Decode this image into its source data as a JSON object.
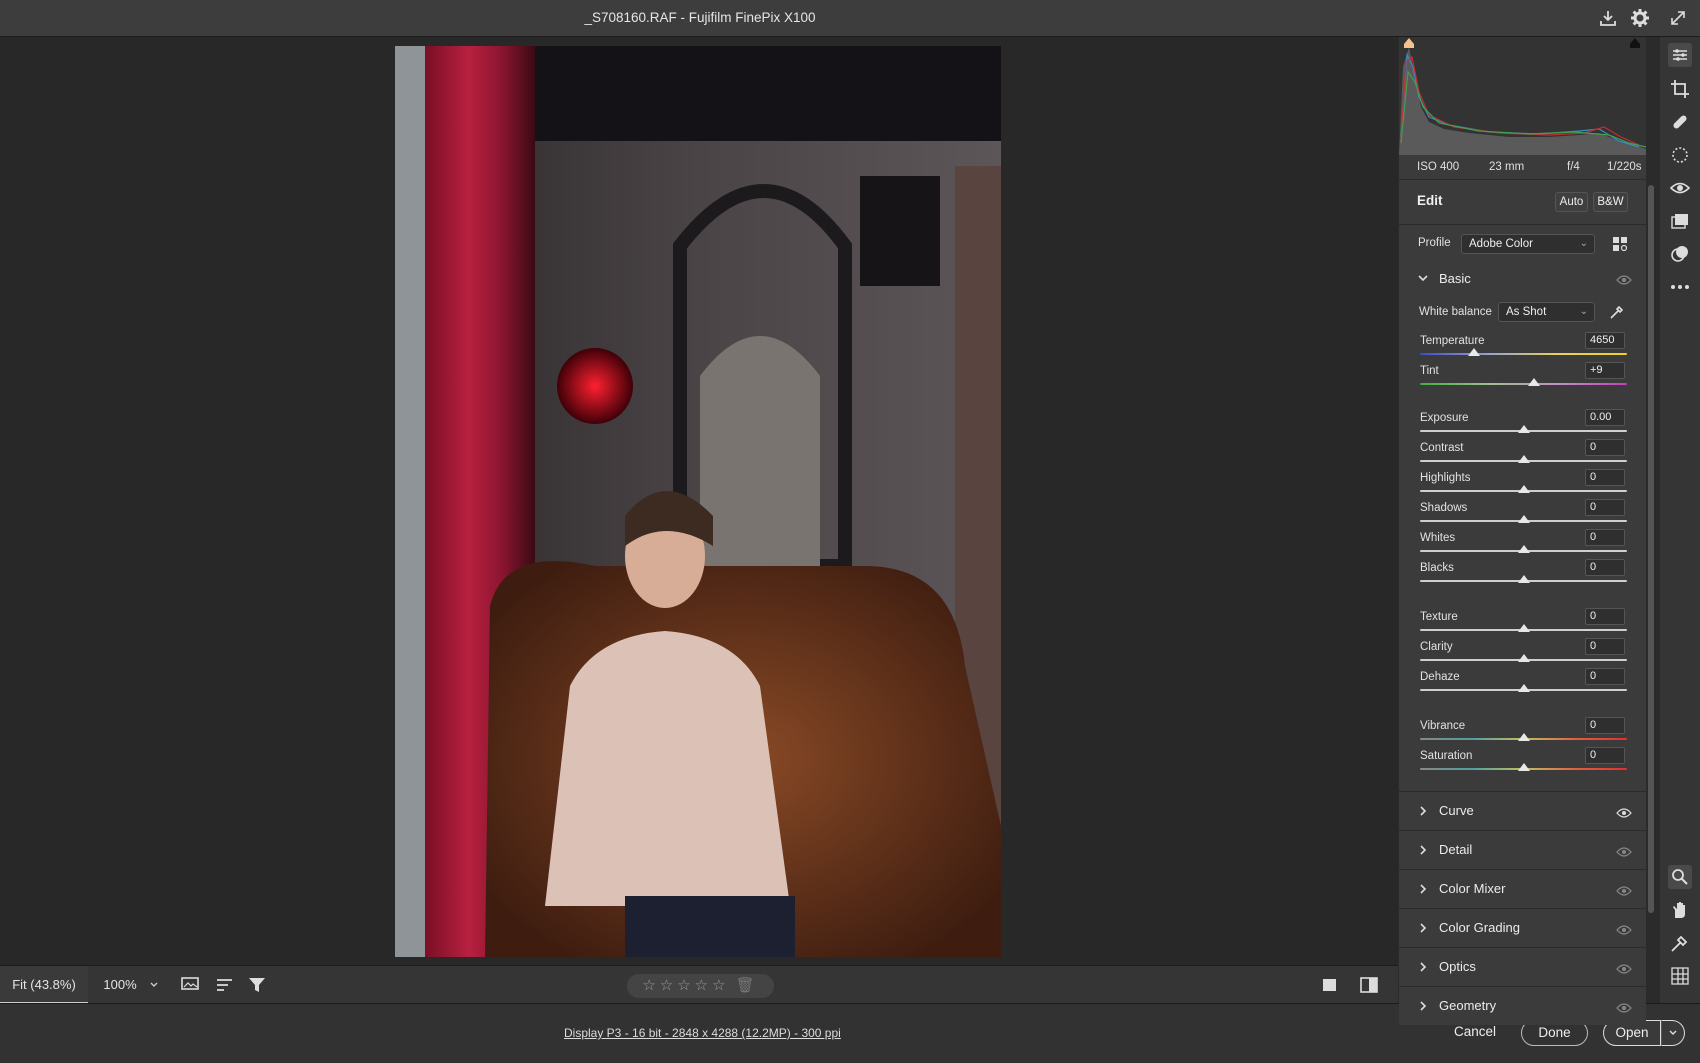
{
  "window": {
    "title": "_S708160.RAF  -  Fujifilm FinePix X100"
  },
  "histogram": {
    "exif": {
      "iso": "ISO 400",
      "focal_length": "23 mm",
      "aperture": "f/4",
      "shutter": "1/220s"
    }
  },
  "edit": {
    "title": "Edit",
    "auto_label": "Auto",
    "bw_label": "B&W",
    "profile_label": "Profile",
    "profile_value": "Adobe Color"
  },
  "basic": {
    "title": "Basic",
    "white_balance_label": "White balance",
    "white_balance_value": "As Shot",
    "sliders": [
      {
        "label": "Temperature",
        "value": "4650",
        "position": 0.26,
        "track": "temp"
      },
      {
        "label": "Tint",
        "value": "+9",
        "position": 0.55,
        "track": "tint"
      },
      {
        "label": "Exposure",
        "value": "0.00",
        "position": 0.5,
        "track": "plain"
      },
      {
        "label": "Contrast",
        "value": "0",
        "position": 0.5,
        "track": "plain"
      },
      {
        "label": "Highlights",
        "value": "0",
        "position": 0.5,
        "track": "plain"
      },
      {
        "label": "Shadows",
        "value": "0",
        "position": 0.5,
        "track": "plain"
      },
      {
        "label": "Whites",
        "value": "0",
        "position": 0.5,
        "track": "plain"
      },
      {
        "label": "Blacks",
        "value": "0",
        "position": 0.5,
        "track": "plain"
      },
      {
        "label": "Texture",
        "value": "0",
        "position": 0.5,
        "track": "plain"
      },
      {
        "label": "Clarity",
        "value": "0",
        "position": 0.5,
        "track": "plain"
      },
      {
        "label": "Dehaze",
        "value": "0",
        "position": 0.5,
        "track": "plain"
      },
      {
        "label": "Vibrance",
        "value": "0",
        "position": 0.5,
        "track": "sat"
      },
      {
        "label": "Saturation",
        "value": "0",
        "position": 0.5,
        "track": "sat"
      }
    ]
  },
  "sections": [
    {
      "name": "Curve"
    },
    {
      "name": "Detail"
    },
    {
      "name": "Color Mixer"
    },
    {
      "name": "Color Grading"
    },
    {
      "name": "Optics"
    },
    {
      "name": "Geometry"
    }
  ],
  "filmstrip": {
    "zoom_fit": "Fit (43.8%)",
    "zoom_100": "100%",
    "stars": "☆☆☆☆☆"
  },
  "footer": {
    "info": "Display P3 - 16 bit - 2848 x 4288 (12.2MP) - 300 ppi",
    "cancel": "Cancel",
    "done": "Done",
    "open": "Open"
  },
  "colors": {
    "accent": "#f4c28a",
    "panel_bg": "#3b3b3b",
    "canvas_bg": "#282828"
  }
}
